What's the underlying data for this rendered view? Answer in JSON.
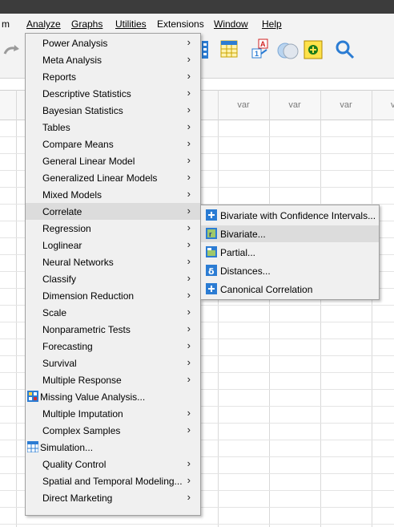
{
  "menubar": {
    "items": [
      {
        "label": "m"
      },
      {
        "label": "Analyze"
      },
      {
        "label": "Graphs"
      },
      {
        "label": "Utilities"
      },
      {
        "label": "Extensions"
      },
      {
        "label": "Window"
      },
      {
        "label": "Help"
      }
    ]
  },
  "grid": {
    "columns": [
      "var",
      "var",
      "var",
      "v"
    ]
  },
  "analyze_menu": {
    "items": [
      {
        "label": "Power Analysis",
        "submenu": true
      },
      {
        "label": "Meta Analysis",
        "submenu": true
      },
      {
        "label": "Reports",
        "submenu": true
      },
      {
        "label": "Descriptive Statistics",
        "submenu": true
      },
      {
        "label": "Bayesian Statistics",
        "submenu": true
      },
      {
        "label": "Tables",
        "submenu": true
      },
      {
        "label": "Compare Means",
        "submenu": true
      },
      {
        "label": "General Linear Model",
        "submenu": true
      },
      {
        "label": "Generalized Linear Models",
        "submenu": true
      },
      {
        "label": "Mixed Models",
        "submenu": true
      },
      {
        "label": "Correlate",
        "submenu": true,
        "highlighted": true
      },
      {
        "label": "Regression",
        "submenu": true
      },
      {
        "label": "Loglinear",
        "submenu": true
      },
      {
        "label": "Neural Networks",
        "submenu": true
      },
      {
        "label": "Classify",
        "submenu": true
      },
      {
        "label": "Dimension Reduction",
        "submenu": true
      },
      {
        "label": "Scale",
        "submenu": true
      },
      {
        "label": "Nonparametric Tests",
        "submenu": true
      },
      {
        "label": "Forecasting",
        "submenu": true
      },
      {
        "label": "Survival",
        "submenu": true
      },
      {
        "label": "Multiple Response",
        "submenu": true
      },
      {
        "label": "Missing Value Analysis...",
        "submenu": false,
        "icon": "missing-value-icon"
      },
      {
        "label": "Multiple Imputation",
        "submenu": true
      },
      {
        "label": "Complex Samples",
        "submenu": true
      },
      {
        "label": "Simulation...",
        "submenu": false,
        "icon": "simulation-icon"
      },
      {
        "label": "Quality Control",
        "submenu": true
      },
      {
        "label": "Spatial and Temporal Modeling...",
        "submenu": true
      },
      {
        "label": "Direct Marketing",
        "submenu": true
      }
    ],
    "arrow": "›"
  },
  "correlate_submenu": {
    "items": [
      {
        "label": "Bivariate with Confidence Intervals...",
        "icon": "plus-icon"
      },
      {
        "label": "Bivariate...",
        "icon": "bivariate-icon",
        "highlighted": true
      },
      {
        "label": "Partial...",
        "icon": "partial-icon"
      },
      {
        "label": "Distances...",
        "icon": "delta-icon"
      },
      {
        "label": "Canonical Correlation",
        "icon": "plus-icon"
      }
    ]
  },
  "colors": {
    "highlight": "#dcdcdc",
    "menu_bg": "#f0f0f0",
    "icon_blue": "#2b7cd3"
  }
}
